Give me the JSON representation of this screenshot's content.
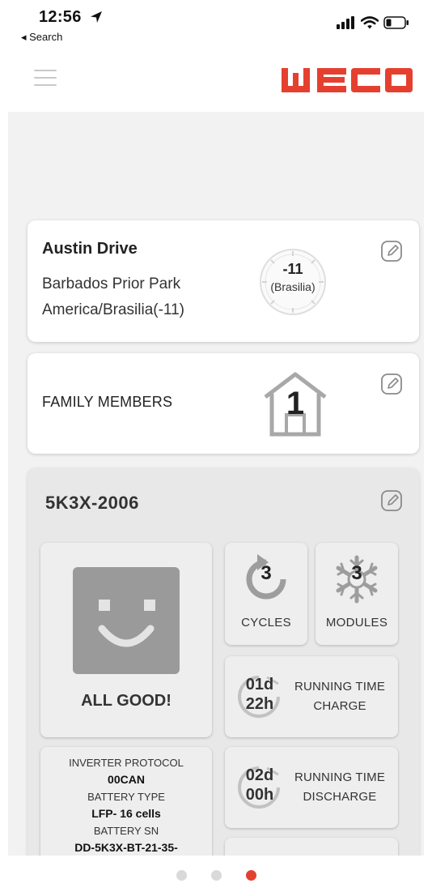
{
  "status_bar": {
    "time": "12:56",
    "back_label": "◂ Search",
    "location_icon": "location-arrow-icon",
    "signal_icon": "cellular-signal-icon",
    "wifi_icon": "wifi-icon",
    "battery_icon": "battery-low-icon"
  },
  "header": {
    "menu_icon": "hamburger-menu-icon",
    "logo_text": "WECO",
    "brand_color": "#e5402f"
  },
  "location_card": {
    "name": "Austin Drive",
    "address": "Barbados Prior Park",
    "timezone": "America/Brasilia(-11)",
    "tz_offset": "-11",
    "tz_city": "(Brasilia)",
    "edit_icon": "edit-icon"
  },
  "family_card": {
    "label": "FAMILY MEMBERS",
    "count": "1",
    "icon": "house-icon",
    "edit_icon": "edit-icon"
  },
  "device": {
    "title": "5K3X-2006",
    "status": "ALL GOOD!",
    "status_icon": "smiley-icon",
    "cycles": {
      "value": "3",
      "label": "CYCLES",
      "icon": "refresh-cycle-icon"
    },
    "modules": {
      "value": "3",
      "label": "MODULES",
      "icon": "snowflake-gear-icon"
    },
    "running_charge": {
      "days": "01d",
      "hours": "22h",
      "label1": "RUNNING TIME",
      "label2": "CHARGE"
    },
    "running_discharge": {
      "days": "02d",
      "hours": "00h",
      "label1": "RUNNING TIME",
      "label2": "DISCHARGE"
    },
    "info": {
      "inverter_protocol_label": "INVERTER PROTOCOL",
      "inverter_protocol_value": "00CAN",
      "battery_type_label": "BATTERY TYPE",
      "battery_type_value": "LFP- 16 cells",
      "battery_sn_label": "BATTERY SN",
      "battery_sn_value": "DD-5K3X-BT-21-35-"
    }
  },
  "pagination": {
    "pages": 3,
    "active": 3
  }
}
